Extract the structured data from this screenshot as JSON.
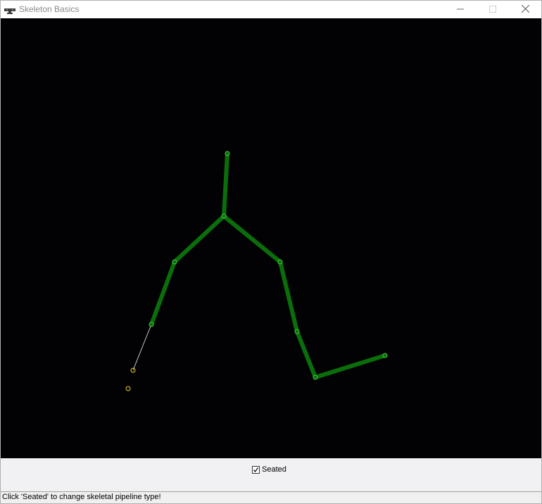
{
  "window": {
    "title": "Skeleton Basics",
    "icon": "kinect-sensor-icon",
    "controls": {
      "minimize": "minimize-icon",
      "maximize": "maximize-icon",
      "close": "close-icon"
    }
  },
  "skeleton": {
    "background_color": "#020204",
    "tracked_bone_color": "#0a6e0a",
    "inferred_bone_color": "#c8c8c8",
    "tracked_joint_color": "#44c844",
    "inferred_joint_color": "#e6d028",
    "joints": [
      "head",
      "shoulder-center",
      "shoulder-left",
      "elbow-left",
      "wrist-left",
      "hand-left",
      "shoulder-right",
      "elbow-right",
      "wrist-right",
      "hand-right",
      "untracked-point"
    ]
  },
  "controls": {
    "seated_label": "Seated",
    "seated_checked": true
  },
  "status": {
    "text": "Click 'Seated' to change skeletal pipeline type!"
  }
}
